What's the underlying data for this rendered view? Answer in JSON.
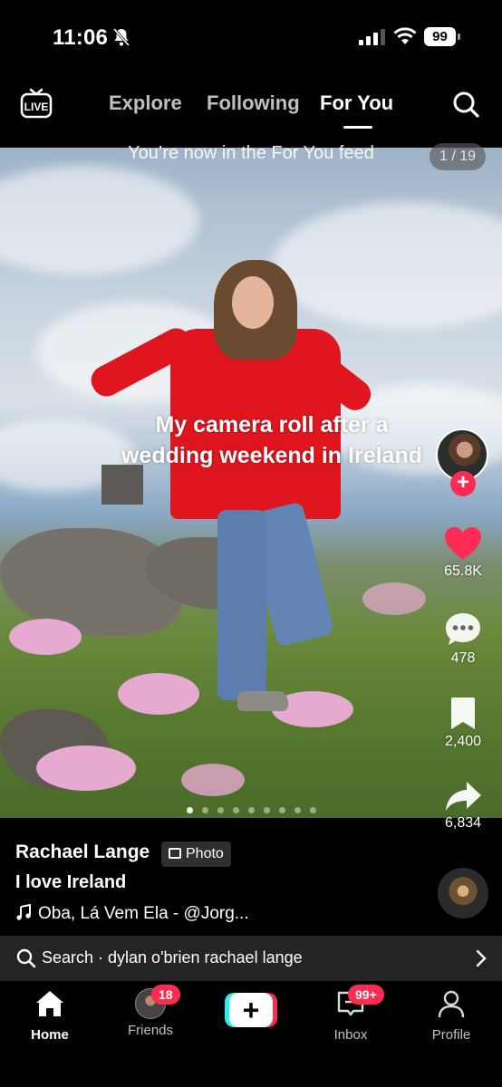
{
  "status_bar": {
    "time": "11:06",
    "battery": "99",
    "icons": [
      "bell-slash-icon",
      "signal-icon",
      "wifi-icon",
      "battery-icon"
    ]
  },
  "top_nav": {
    "live_icon": "live-tv-icon",
    "tabs": [
      {
        "label": "Explore",
        "active": false
      },
      {
        "label": "Following",
        "active": false
      },
      {
        "label": "For You",
        "active": true
      }
    ],
    "search_icon": "search-icon"
  },
  "feed": {
    "notice": "You’re now in the For You feed",
    "page_counter": "1 / 19",
    "overlay_caption": "My camera roll after a wedding weekend in Ireland",
    "slide_count": 9,
    "active_slide": 0
  },
  "actions": {
    "follow_symbol": "+",
    "like_count": "65.8K",
    "comment_count": "478",
    "save_count": "2,400",
    "share_count": "6,834"
  },
  "post": {
    "creator": "Rachael Lange",
    "badge": "Photo",
    "caption": "I love Ireland",
    "music": "Oba, Lá Vem Ela - @Jorg..."
  },
  "search_suggestion": {
    "text": "Search · dylan o'brien rachael lange"
  },
  "tab_bar": {
    "home": "Home",
    "friends": "Friends",
    "friends_badge": "18",
    "create_symbol": "+",
    "inbox": "Inbox",
    "inbox_badge": "99+",
    "profile": "Profile"
  },
  "colors": {
    "accent_red": "#fe2c55",
    "accent_cyan": "#25f4ee",
    "background": "#000000",
    "search_bar_bg": "#242424"
  }
}
